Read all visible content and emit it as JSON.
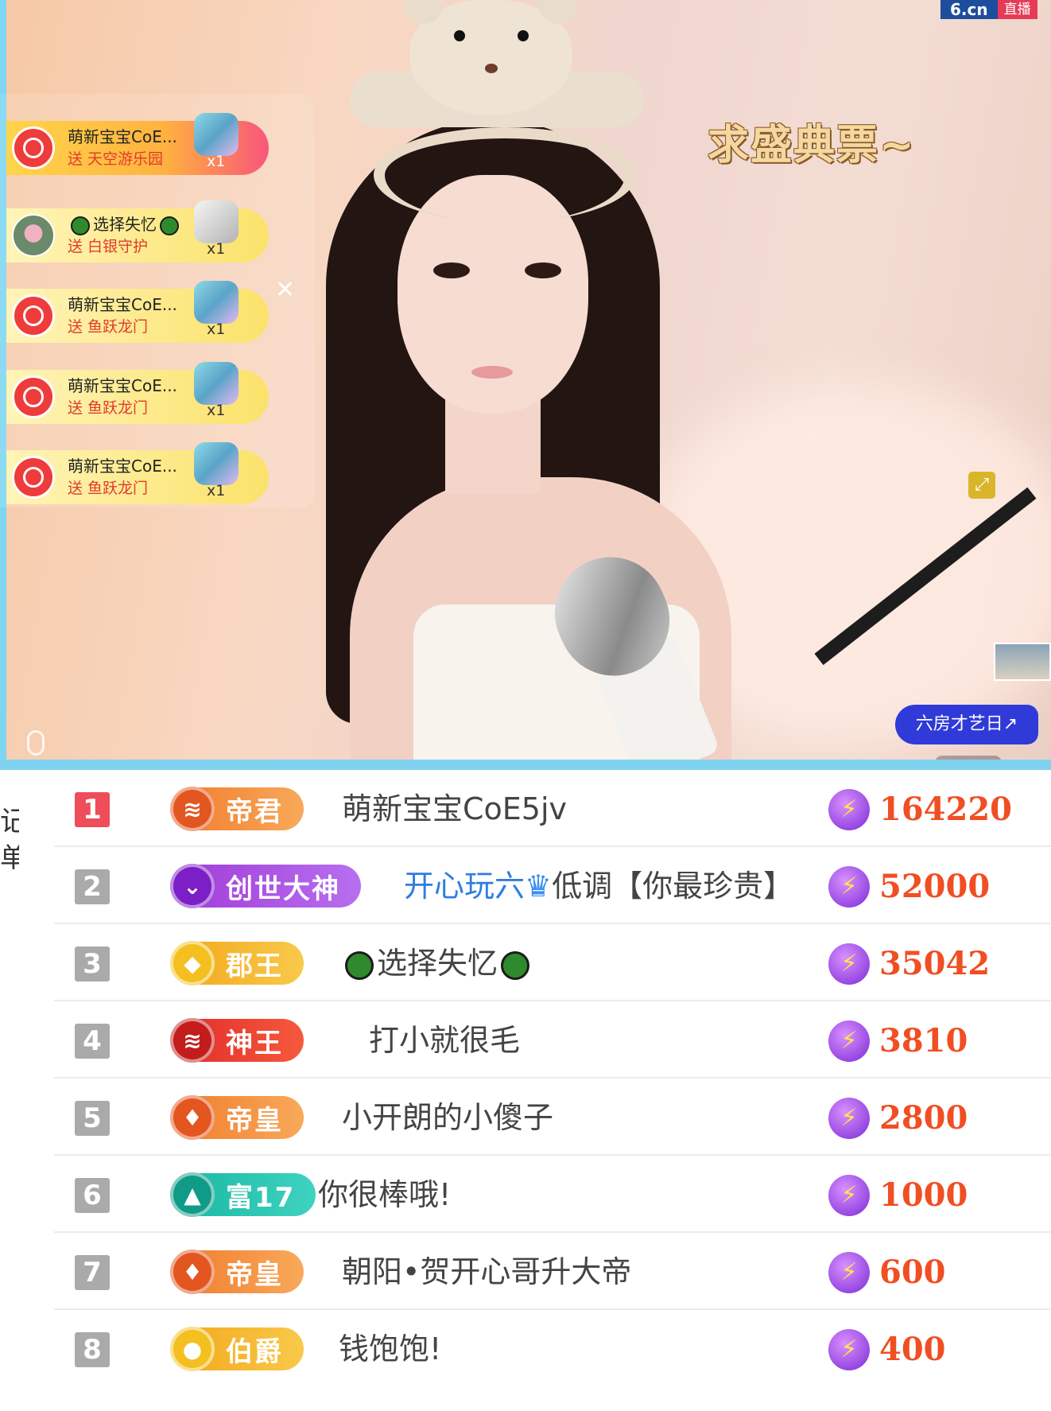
{
  "stream": {
    "logo_site": "6.cn",
    "logo_tag": "直播",
    "banner_text": "求盛典票~",
    "close_symbol": "✕",
    "expand_symbol": "⤢",
    "promo_label": "六房才艺日↗",
    "gift_feed": [
      {
        "name": "萌新宝宝CoE...",
        "gift_text": "送 天空游乐园",
        "count": "x1",
        "avatar": "red-face-avatar",
        "style": "first"
      },
      {
        "name": "选择失忆",
        "gift_text": "送 白银守护",
        "count": "x1",
        "avatar": "photo-avatar",
        "style": "normal"
      },
      {
        "name": "萌新宝宝CoE...",
        "gift_text": "送 鱼跃龙门",
        "count": "x1",
        "avatar": "red-face-avatar",
        "style": "normal"
      },
      {
        "name": "萌新宝宝CoE...",
        "gift_text": "送 鱼跃龙门",
        "count": "x1",
        "avatar": "red-face-avatar",
        "style": "normal"
      },
      {
        "name": "萌新宝宝CoE...",
        "gift_text": "送 鱼跃龙门",
        "count": "x1",
        "avatar": "red-face-avatar",
        "style": "normal"
      }
    ]
  },
  "ranking": {
    "side_label": "记单",
    "rows": [
      {
        "rank": "1",
        "badge": "帝君",
        "badge_color": "#f07b2c",
        "user": "萌新宝宝CoE5jv",
        "score": "164220"
      },
      {
        "rank": "2",
        "badge": "创世大神",
        "badge_color": "#a23bd8",
        "user_blue": "开心玩六",
        "user": "低调【你最珍贵】",
        "score": "52000"
      },
      {
        "rank": "3",
        "badge": "郡王",
        "badge_color": "#f2a71a",
        "user": "选择失忆",
        "score": "35042"
      },
      {
        "rank": "4",
        "badge": "神王",
        "badge_color": "#e22a2a",
        "user": "打小就很毛",
        "score": "3810"
      },
      {
        "rank": "5",
        "badge": "帝皇",
        "badge_color": "#f07b2c",
        "user": "小开朗的小傻子",
        "score": "2800"
      },
      {
        "rank": "6",
        "badge": "富17",
        "badge_color": "#18b7a1",
        "user": "你很棒哦!",
        "score": "1000"
      },
      {
        "rank": "7",
        "badge": "帝皇",
        "badge_color": "#f07b2c",
        "user": "朝阳•贺开心哥升大帝",
        "score": "600"
      },
      {
        "rank": "8",
        "badge": "伯爵",
        "badge_color": "#f2a71a",
        "user": "钱饱饱!",
        "score": "400"
      }
    ]
  }
}
